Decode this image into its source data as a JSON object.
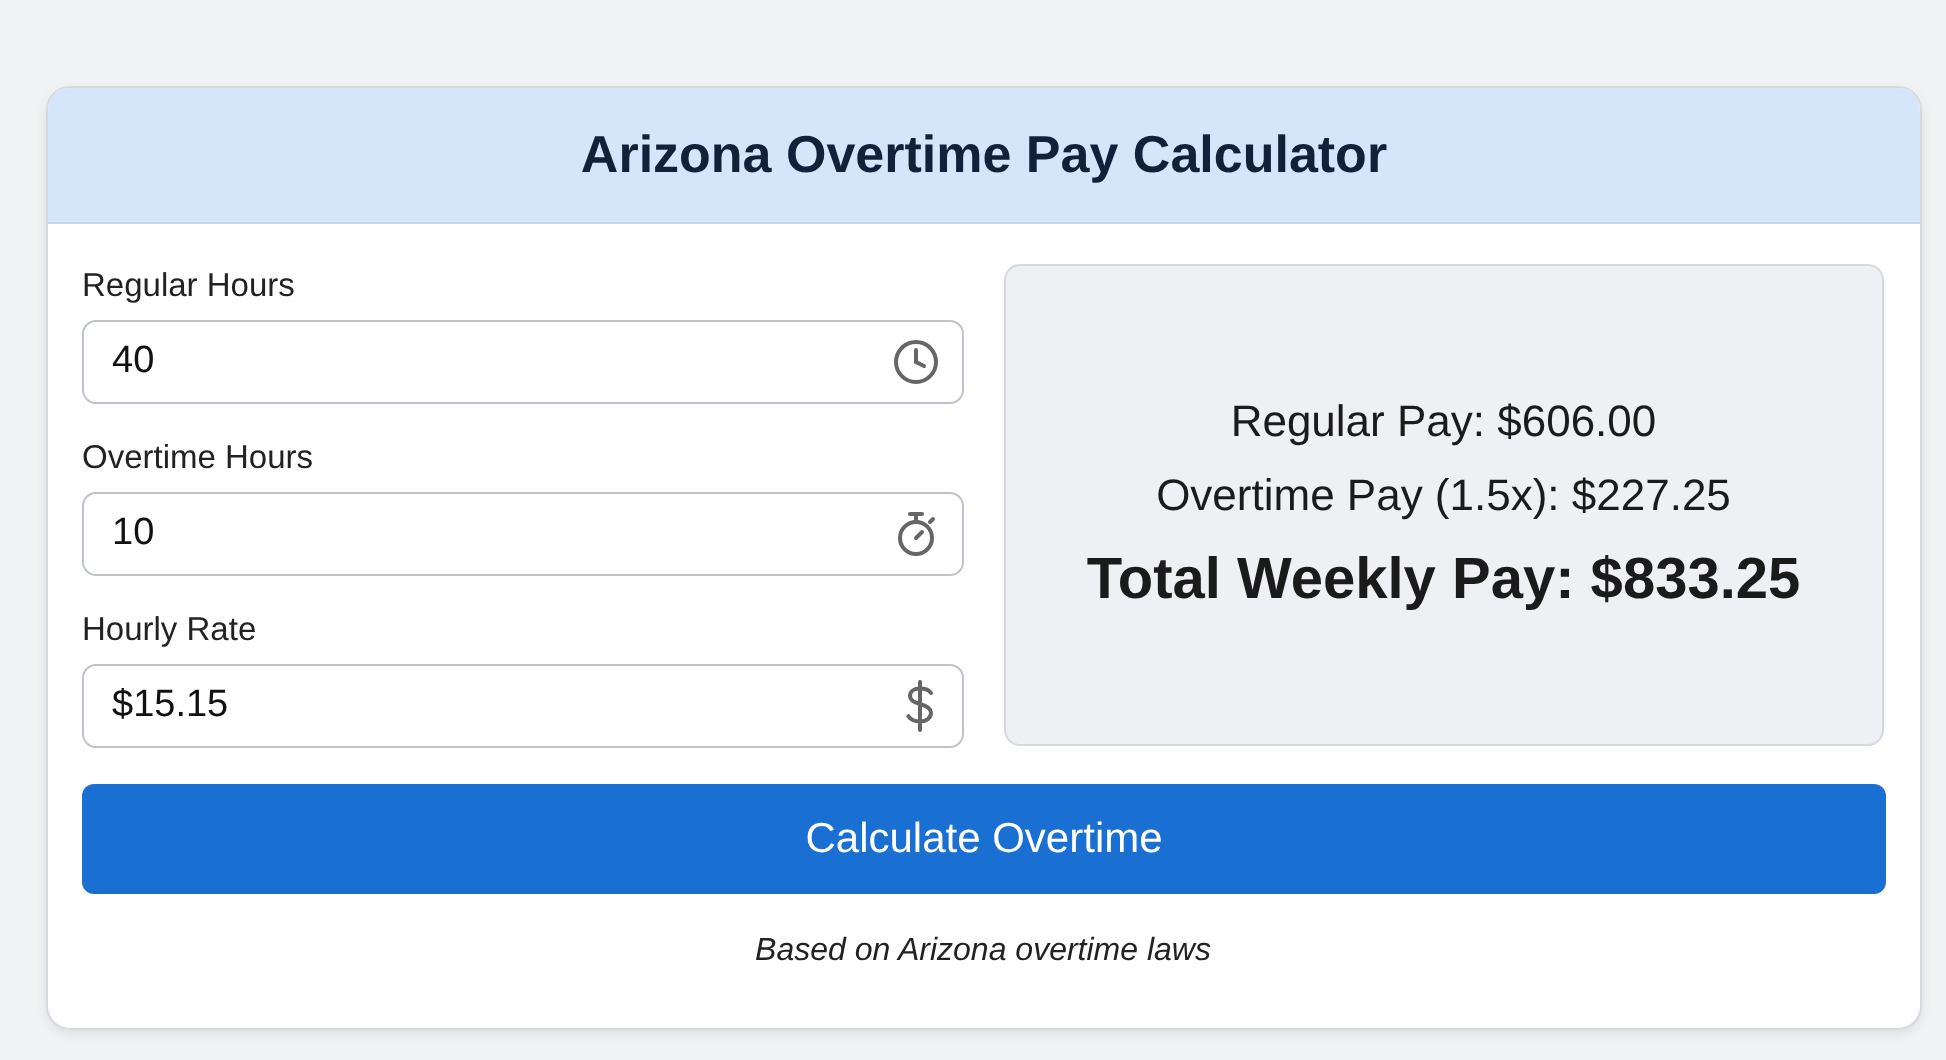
{
  "title": "Arizona Overtime Pay Calculator",
  "fields": [
    {
      "label": "Regular Hours",
      "value": "40",
      "kind": "clock"
    },
    {
      "label": "Overtime Hours",
      "value": "10",
      "kind": "stopwatch"
    },
    {
      "label": "Hourly Rate",
      "value": "$15.15",
      "kind": "dollar"
    }
  ],
  "results": [
    {
      "kind": "line",
      "text": "Regular Pay: $606.00"
    },
    {
      "kind": "line",
      "text": "Overtime Pay (1.5x): $227.25"
    },
    {
      "kind": "total",
      "text": "Total Weekly Pay: $833.25"
    }
  ],
  "button": "Calculate Overtime",
  "note": "Based on Arizona overtime laws"
}
